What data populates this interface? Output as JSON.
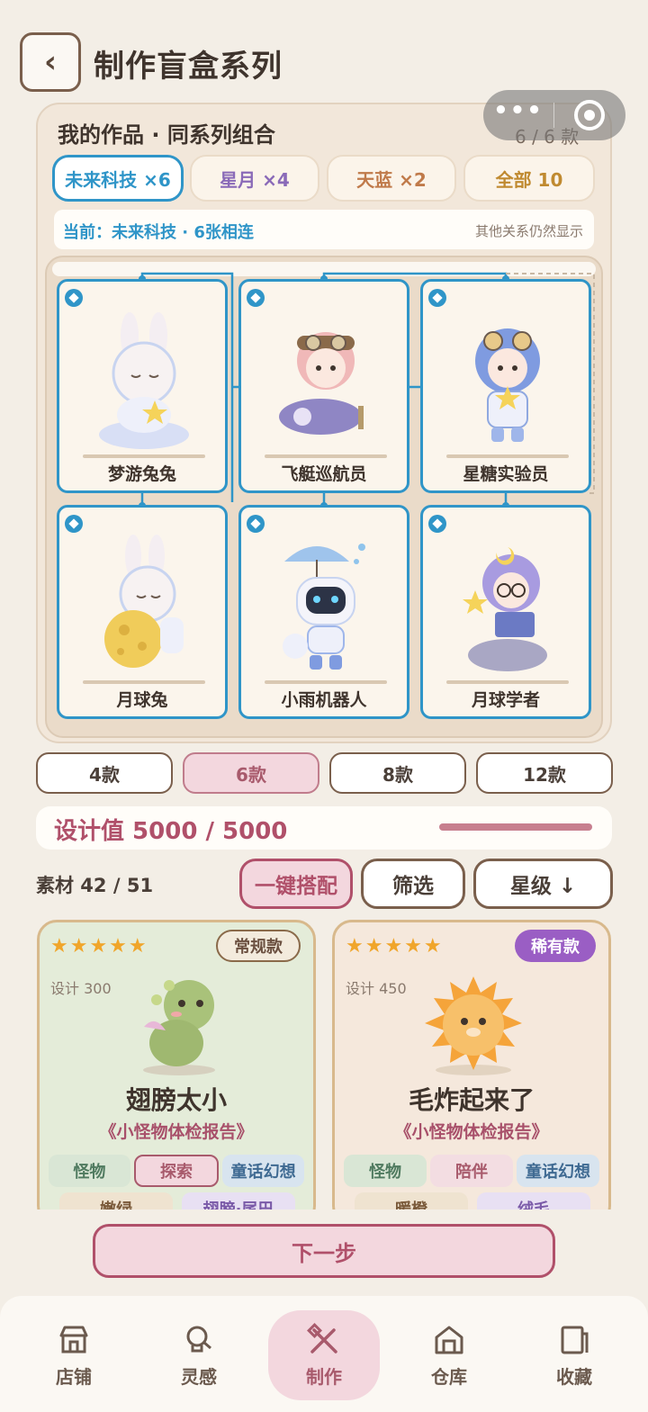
{
  "header": {
    "back_icon": "‹",
    "title": "制作盲盒系列"
  },
  "panel": {
    "title": "我的作品 · 同系列组合",
    "count": "6 / 6 款",
    "chips": [
      {
        "label": "未来科技 ×6",
        "color": "#2f95c8",
        "active": true
      },
      {
        "label": "星月 ×4",
        "color": "#8a6ab8",
        "active": false
      },
      {
        "label": "天蓝 ×2",
        "color": "#c07a4a",
        "active": false
      },
      {
        "label": "全部 10",
        "color": "#c08a30",
        "active": false
      }
    ],
    "current": "当前：未来科技 · 6张相连",
    "note": "其他关系仍然显示",
    "cards": [
      {
        "label": "梦游兔兔",
        "icon": "sleeping-bunny-figure"
      },
      {
        "label": "飞艇巡航员",
        "icon": "airship-pilot-figure"
      },
      {
        "label": "星糖实验员",
        "icon": "star-scientist-figure"
      },
      {
        "label": "月球兔",
        "icon": "moon-bunny-figure"
      },
      {
        "label": "小雨机器人",
        "icon": "rain-robot-figure"
      },
      {
        "label": "月球学者",
        "icon": "moon-scholar-figure"
      }
    ]
  },
  "counts": [
    {
      "label": "4款",
      "active": false
    },
    {
      "label": "6款",
      "active": true
    },
    {
      "label": "8款",
      "active": false
    },
    {
      "label": "12款",
      "active": false
    }
  ],
  "design": {
    "label": "设计值 5000 / 5000",
    "progress": 1.0
  },
  "materials": {
    "count": "素材 42 / 51",
    "match_button": "一键搭配",
    "filter_button": "筛选",
    "sort_button": "星级 ↓",
    "cards": [
      {
        "stars": "★★★★★",
        "badge": "常规款",
        "design": "设计 300",
        "name": "翅膀太小",
        "series": "《小怪物体检报告》",
        "tags": [
          "怪物",
          "探索",
          "童话幻想"
        ],
        "tags2": [
          "嫩绿",
          "翅膀·尾巴"
        ]
      },
      {
        "stars": "★★★★★",
        "badge": "稀有款",
        "design": "设计 450",
        "name": "毛炸起来了",
        "series": "《小怪物体检报告》",
        "tags": [
          "怪物",
          "陪伴",
          "童话幻想"
        ],
        "tags2": [
          "暖橙",
          "绒毛"
        ]
      }
    ]
  },
  "next_button": "下一步",
  "tabs": [
    {
      "label": "店铺",
      "icon": "store-icon",
      "active": false
    },
    {
      "label": "灵感",
      "icon": "lightbulb-icon",
      "active": false
    },
    {
      "label": "制作",
      "icon": "tools-icon",
      "active": true
    },
    {
      "label": "仓库",
      "icon": "warehouse-icon",
      "active": false
    },
    {
      "label": "收藏",
      "icon": "collection-icon",
      "active": false
    }
  ],
  "colors": {
    "accent_blue": "#2f95c8",
    "accent_pink": "#b0506a",
    "background": "#f3eee6"
  }
}
